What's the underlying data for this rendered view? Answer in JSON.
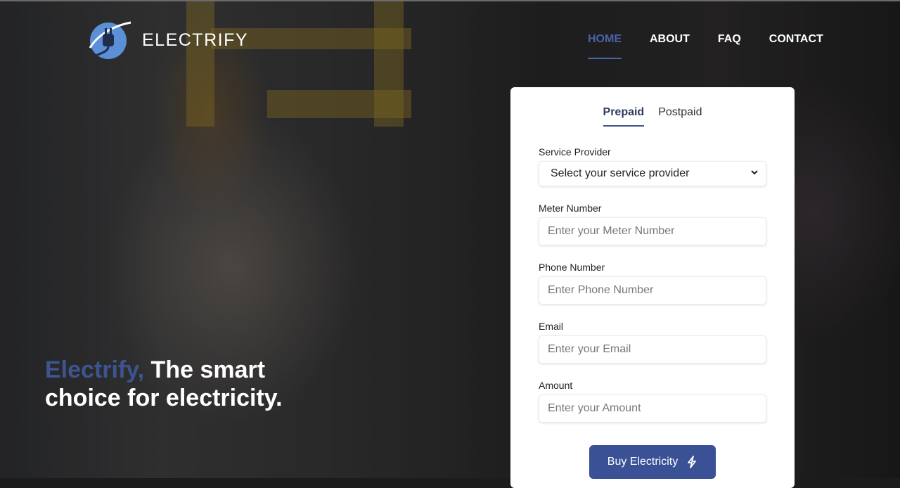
{
  "brand": {
    "name": "ELECTRIFY"
  },
  "nav": {
    "items": [
      {
        "label": "HOME",
        "active": true
      },
      {
        "label": "ABOUT",
        "active": false
      },
      {
        "label": "FAQ",
        "active": false
      },
      {
        "label": "CONTACT",
        "active": false
      }
    ]
  },
  "hero": {
    "brand_word": "Electrify,",
    "tagline_rest": " The smart choice for electricity."
  },
  "form": {
    "tabs": [
      {
        "label": "Prepaid",
        "active": true
      },
      {
        "label": "Postpaid",
        "active": false
      }
    ],
    "service_provider": {
      "label": "Service Provider",
      "value": "Select your service provider"
    },
    "meter_number": {
      "label": "Meter Number",
      "placeholder": "Enter your Meter Number"
    },
    "phone_number": {
      "label": "Phone Number",
      "placeholder": "Enter Phone Number"
    },
    "email": {
      "label": "Email",
      "placeholder": "Enter your Email"
    },
    "amount": {
      "label": "Amount",
      "placeholder": "Enter your Amount"
    },
    "submit_label": "Buy Electricity",
    "submit_icon": "lightning-bolt-icon"
  },
  "colors": {
    "accent": "#3a5195",
    "nav_active": "#4a62a8",
    "brand_text": "#3e5491"
  }
}
